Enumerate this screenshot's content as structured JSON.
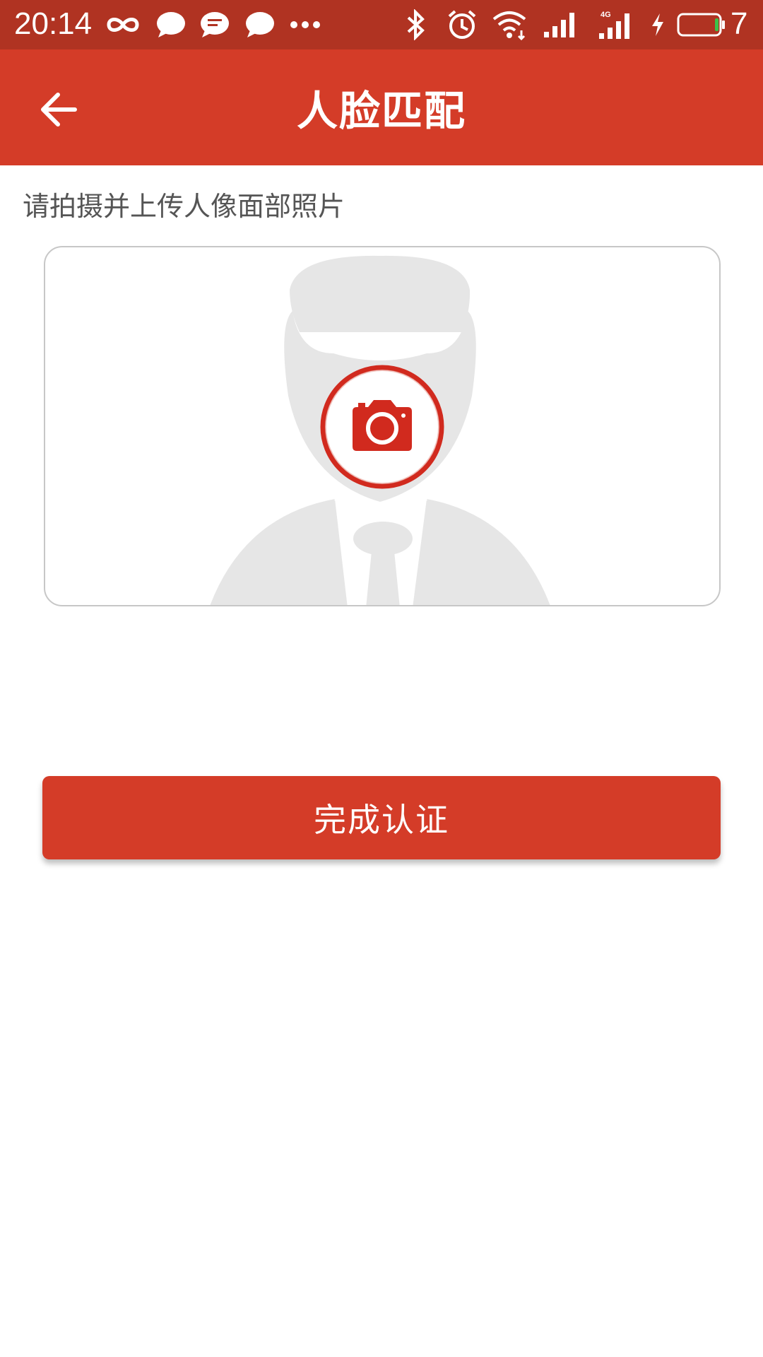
{
  "status_bar": {
    "time": "20:14",
    "battery_level": "7",
    "network_label": "4G",
    "icons": [
      "infinity-icon",
      "chat-bubble-icon",
      "message-icon",
      "chat-bubble-icon",
      "more-dots-icon",
      "bluetooth-icon",
      "alarm-icon",
      "wifi-icon",
      "signal-icon",
      "signal-4g-icon",
      "charging-icon",
      "battery-icon"
    ]
  },
  "header": {
    "title": "人脸匹配",
    "back_icon": "arrow-left-icon"
  },
  "main": {
    "instruction": "请拍摄并上传人像面部照片",
    "photo_placeholder_icon": "person-silhouette-icon",
    "camera_icon": "camera-icon"
  },
  "actions": {
    "submit_label": "完成认证"
  },
  "colors": {
    "status_bar": "#B03322",
    "primary": "#D43C28",
    "camera_red": "#D12A1E",
    "text_secondary": "#555555",
    "border": "#C7C7C7",
    "silhouette": "#E6E6E6",
    "battery_green": "#3CC24A"
  }
}
